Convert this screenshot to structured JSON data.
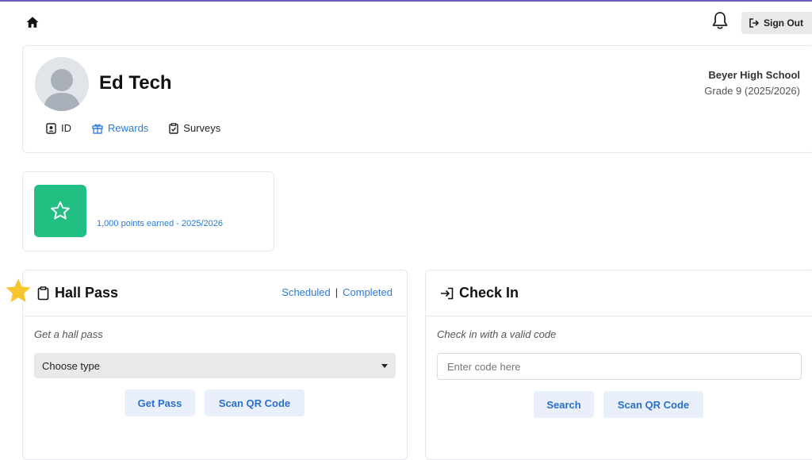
{
  "header": {
    "sign_out_label": "Sign Out",
    "icons": [
      "home-icon",
      "bell-icon",
      "sign-out-icon"
    ]
  },
  "profile": {
    "name": "Ed Tech",
    "school": "Beyer High School",
    "grade": "Grade 9 (2025/2026)",
    "tabs": [
      {
        "label": "ID",
        "icon": "id-badge-icon"
      },
      {
        "label": "Rewards",
        "icon": "gift-icon",
        "active": true
      },
      {
        "label": "Surveys",
        "icon": "clipboard-check-icon"
      }
    ]
  },
  "points": {
    "text": "1,000 points earned - 2025/2026",
    "icon": "star-icon",
    "color": "#23be82"
  },
  "hall_pass": {
    "title": "Hall Pass",
    "link_scheduled": "Scheduled",
    "link_separator": "|",
    "link_completed": "Completed",
    "hint": "Get a hall pass",
    "select_value": "Choose type",
    "get_pass_label": "Get Pass",
    "scan_label": "Scan QR Code"
  },
  "check_in": {
    "title": "Check In",
    "hint": "Check in with a valid code",
    "input_placeholder": "Enter code here",
    "search_label": "Search",
    "scan_label": "Scan QR Code"
  },
  "colors": {
    "accent": "#2a7bd6",
    "points_green": "#23be82",
    "star_yellow": "#f7c62f"
  }
}
